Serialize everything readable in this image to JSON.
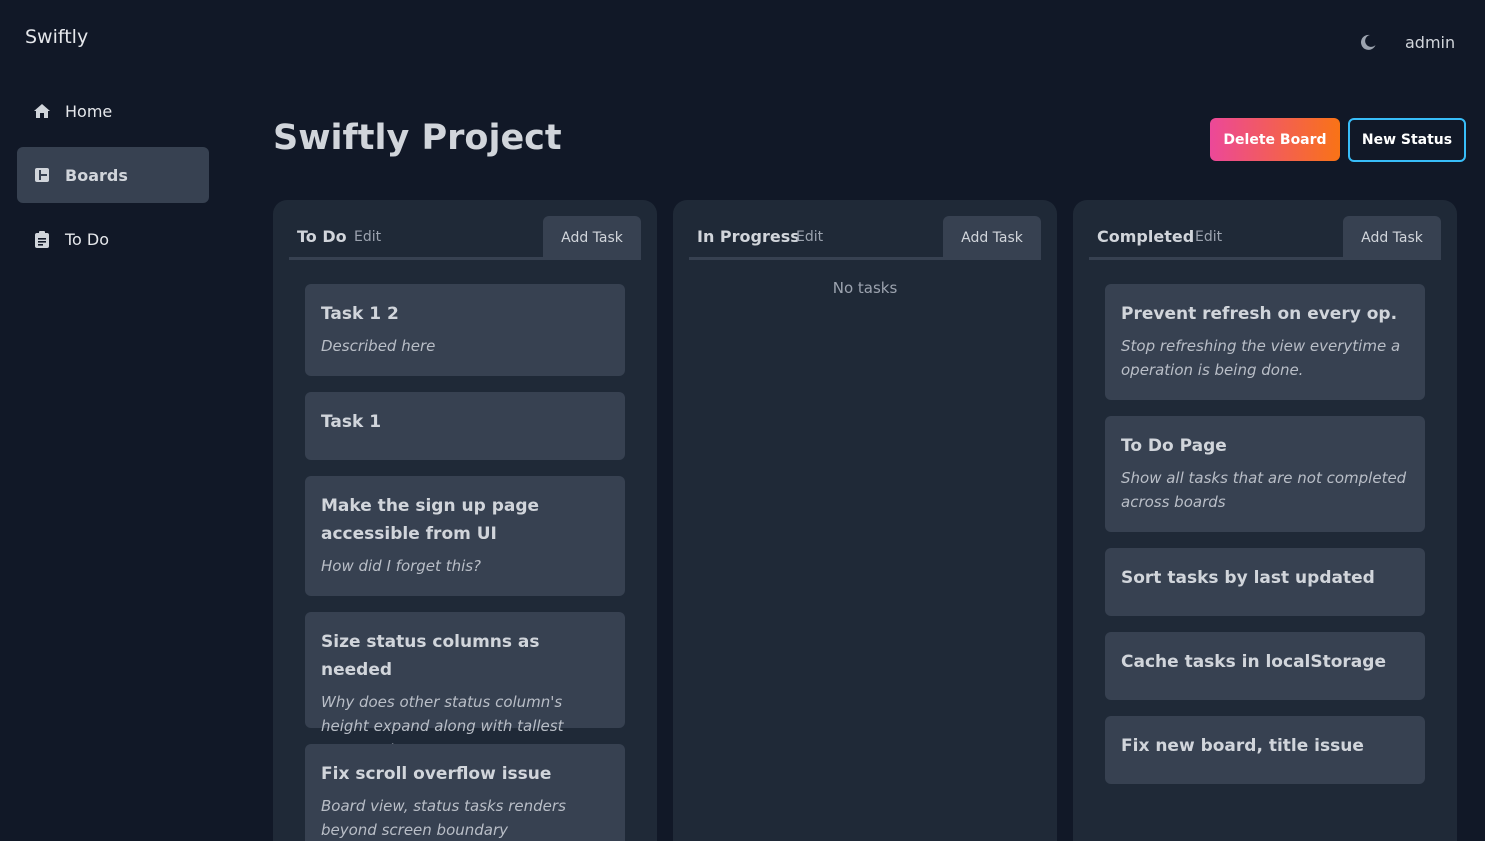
{
  "app": {
    "brand": "Swiftly",
    "user": "admin"
  },
  "icons": {
    "theme": "moon-icon",
    "home": "home-icon",
    "boards": "boards-icon",
    "todo": "clipboard-icon"
  },
  "sidebar": {
    "items": [
      {
        "label": "Home",
        "active": false
      },
      {
        "label": "Boards",
        "active": true
      },
      {
        "label": "To Do",
        "active": false
      }
    ]
  },
  "header": {
    "title": "Swiftly Project",
    "delete_label": "Delete Board",
    "new_status_label": "New Status"
  },
  "colors": {
    "background": "#111827",
    "column": "#1f2937",
    "card": "#374151",
    "accent": "#38bdf8",
    "gradient_start": "#ec4899",
    "gradient_end": "#f97316"
  },
  "columns": [
    {
      "title": "To Do",
      "edit_label": "Edit",
      "add_label": "Add Task",
      "tasks": [
        {
          "title": "Task 1 2",
          "description": "Described here"
        },
        {
          "title": "Task 1",
          "description": ""
        },
        {
          "title": "Make the sign up page accessible from UI",
          "description": "How did I forget this?"
        },
        {
          "title": "Size status columns as needed",
          "description": "Why does other status column's height expand along with tallest status column?"
        },
        {
          "title": "Fix scroll overflow issue",
          "description": "Board view, status tasks renders beyond screen boundary"
        }
      ]
    },
    {
      "title": "In Progress",
      "edit_label": "Edit",
      "add_label": "Add Task",
      "empty_text": "No tasks",
      "tasks": []
    },
    {
      "title": "Completed",
      "edit_label": "Edit",
      "add_label": "Add Task",
      "tasks": [
        {
          "title": "Prevent refresh on every op.",
          "description": "Stop refreshing the view everytime a operation is being done."
        },
        {
          "title": "To Do Page",
          "description": "Show all tasks that are not completed across boards"
        },
        {
          "title": "Sort tasks by last updated",
          "description": ""
        },
        {
          "title": "Cache tasks in localStorage",
          "description": ""
        },
        {
          "title": "Fix new board, title issue",
          "description": ""
        }
      ]
    }
  ]
}
